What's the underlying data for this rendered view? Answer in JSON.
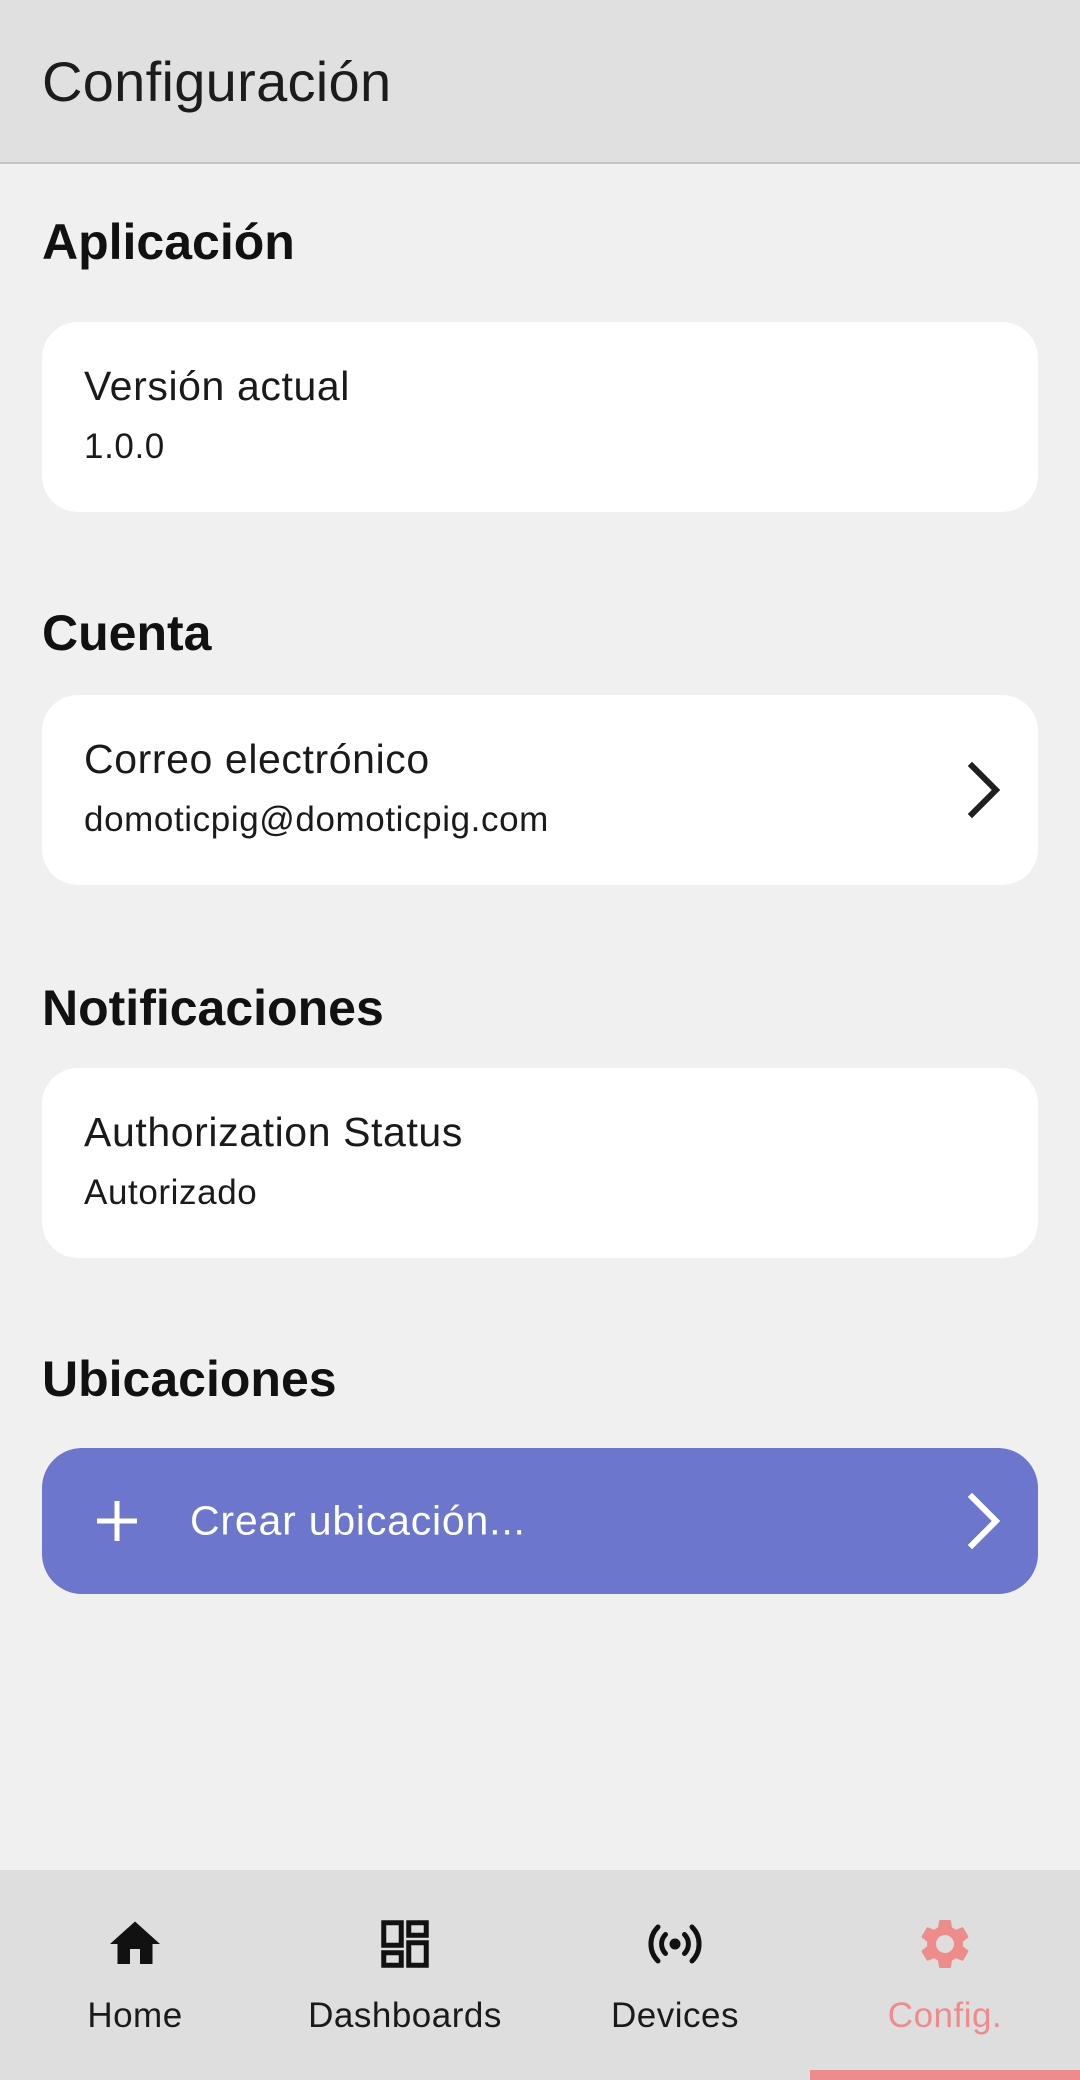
{
  "app_bar": {
    "title": "Configuración"
  },
  "sections": {
    "app": {
      "title": "Aplicación",
      "item": {
        "title": "Versión actual",
        "subtitle": "1.0.0"
      }
    },
    "account": {
      "title": "Cuenta",
      "item": {
        "title": "Correo electrónico",
        "subtitle": "domoticpig@domoticpig.com"
      }
    },
    "notifications": {
      "title": "Notificaciones",
      "item": {
        "title": "Authorization Status",
        "subtitle": "Autorizado"
      }
    },
    "locations": {
      "title": "Ubicaciones",
      "action_label": "Crear ubicación..."
    }
  },
  "bottom_nav": {
    "items": [
      {
        "label": "Home",
        "icon": "home-icon"
      },
      {
        "label": "Dashboards",
        "icon": "dashboard-icon"
      },
      {
        "label": "Devices",
        "icon": "broadcast-icon"
      },
      {
        "label": "Config.",
        "icon": "gear-icon"
      }
    ],
    "active_index": 3
  },
  "colors": {
    "accent": "#6b76cc",
    "active_nav": "#ee8b8b",
    "app_bar": "#e0e0e0",
    "background": "#f0f0f0"
  }
}
